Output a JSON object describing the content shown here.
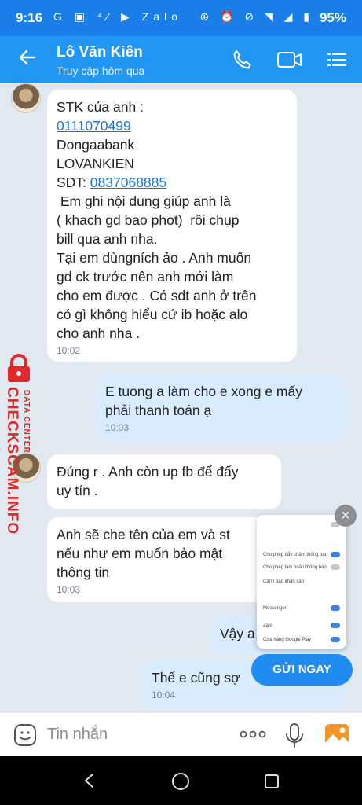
{
  "status_bar": {
    "time": "9:16",
    "left_icons": "G ▣ ⁴⁄ ▶ Zalo",
    "right_icons": "⊕ ⏰ ⊘ ◥ ◢ ▮",
    "battery": "95%"
  },
  "header": {
    "contact_name": "Lô Văn Kiên",
    "last_seen": "Truy cập hôm qua",
    "icons": [
      "back-arrow-icon",
      "phone-icon",
      "video-icon",
      "menu-list-icon"
    ]
  },
  "messages": [
    {
      "dir": "in",
      "line1": "STK của anh :",
      "account_number": "0111070499",
      "line3": "Dongaabank\nLOVANKIEN",
      "sdt_label": "SDT: ",
      "phone": "0837068885",
      "body": " Em ghi nội dung giúp anh là\n( khach gd bao phot)  rồi chụp\nbill qua anh nha.\nTại em dùngních ảo . Anh muốn\ngd ck trước nên anh mới làm\ncho em được . Có sdt anh ở trên\ncó gì không hiểu cứ ib hoặc alo\ncho anh nha .",
      "time": "10:02"
    },
    {
      "dir": "out",
      "text": "E tuong a làm cho e xong e mấy\nphải thanh toán ạ",
      "time": "10:03"
    },
    {
      "dir": "in",
      "text": "Đúng r . Anh còn up fb để đấy\nuy tín ."
    },
    {
      "dir": "in",
      "text": "Anh sẽ che tên của em và st\nnếu như em muốn bảo mật\nthông tin",
      "time": "10:03"
    },
    {
      "dir": "out",
      "text": "Vậy a"
    },
    {
      "dir": "out",
      "text": "Thế e cũng sợ",
      "time": "10:04"
    }
  ],
  "watermark": {
    "brand": "CHECKSCAM.INFO",
    "sub": "DATA CENTER"
  },
  "overlay": {
    "popup_rows": [
      "Cho phép đẩy chấm thông báo",
      "Cho phép làm hoãn thông báo",
      "Cảnh báo khẩn cấp",
      "Messenger",
      "Zalo",
      "Cửa hàng Google Play"
    ],
    "send_now_label": "GỬI NGAY",
    "close_label": "×"
  },
  "input_bar": {
    "placeholder": "Tin nhắn",
    "more_label": "ooo"
  },
  "colors": {
    "header_blue": "#2196f3",
    "status_blue": "#1a7fe9",
    "outgoing_bubble": "#d8ecfd",
    "link": "#1a74d8",
    "watermark_red": "#e0292a"
  }
}
